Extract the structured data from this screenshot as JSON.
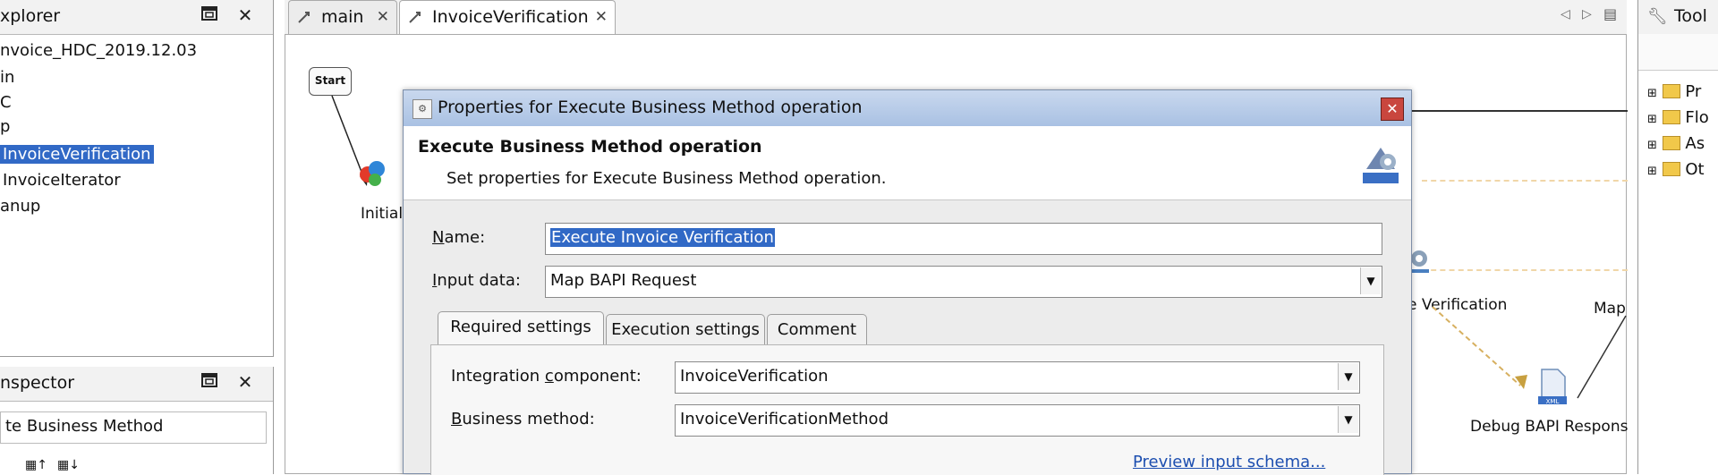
{
  "explorer": {
    "title": "xplorer",
    "items": [
      {
        "label": "nvoice_HDC_2019.12.03"
      },
      {
        "label": "in"
      },
      {
        "label": "C"
      },
      {
        "label": "p"
      },
      {
        "label": "InvoiceVerification"
      },
      {
        "label": "InvoiceIterator"
      },
      {
        "label": "anup"
      }
    ]
  },
  "inspector": {
    "title": "nspector",
    "value": "te Business Method"
  },
  "editor": {
    "tabs": [
      {
        "label": "main"
      },
      {
        "label": "InvoiceVerification"
      }
    ],
    "start_label": "Start",
    "initial_label": "Initial",
    "verification_label": "e Verification",
    "map_label": "Map",
    "debug_label": "Debug BAPI Respons"
  },
  "tool": {
    "title": "Tool",
    "items": [
      {
        "label": "Pr"
      },
      {
        "label": "Flo"
      },
      {
        "label": "As"
      },
      {
        "label": "Ot"
      }
    ]
  },
  "dialog": {
    "title": "Properties for Execute Business Method operation",
    "heading": "Execute Business Method operation",
    "description": "Set properties for Execute Business Method operation.",
    "name_label": "Name:",
    "name_value": "Execute Invoice Verification",
    "input_label": "Input data:",
    "input_value": "Map BAPI Request",
    "tabs": [
      {
        "label": "Required settings"
      },
      {
        "label": "Execution settings"
      },
      {
        "label": "Comment"
      }
    ],
    "component_label": "Integration component:",
    "component_value": "InvoiceVerification",
    "method_label": "Business method:",
    "method_value": "InvoiceVerificationMethod",
    "preview_link": "Preview input schema..."
  }
}
